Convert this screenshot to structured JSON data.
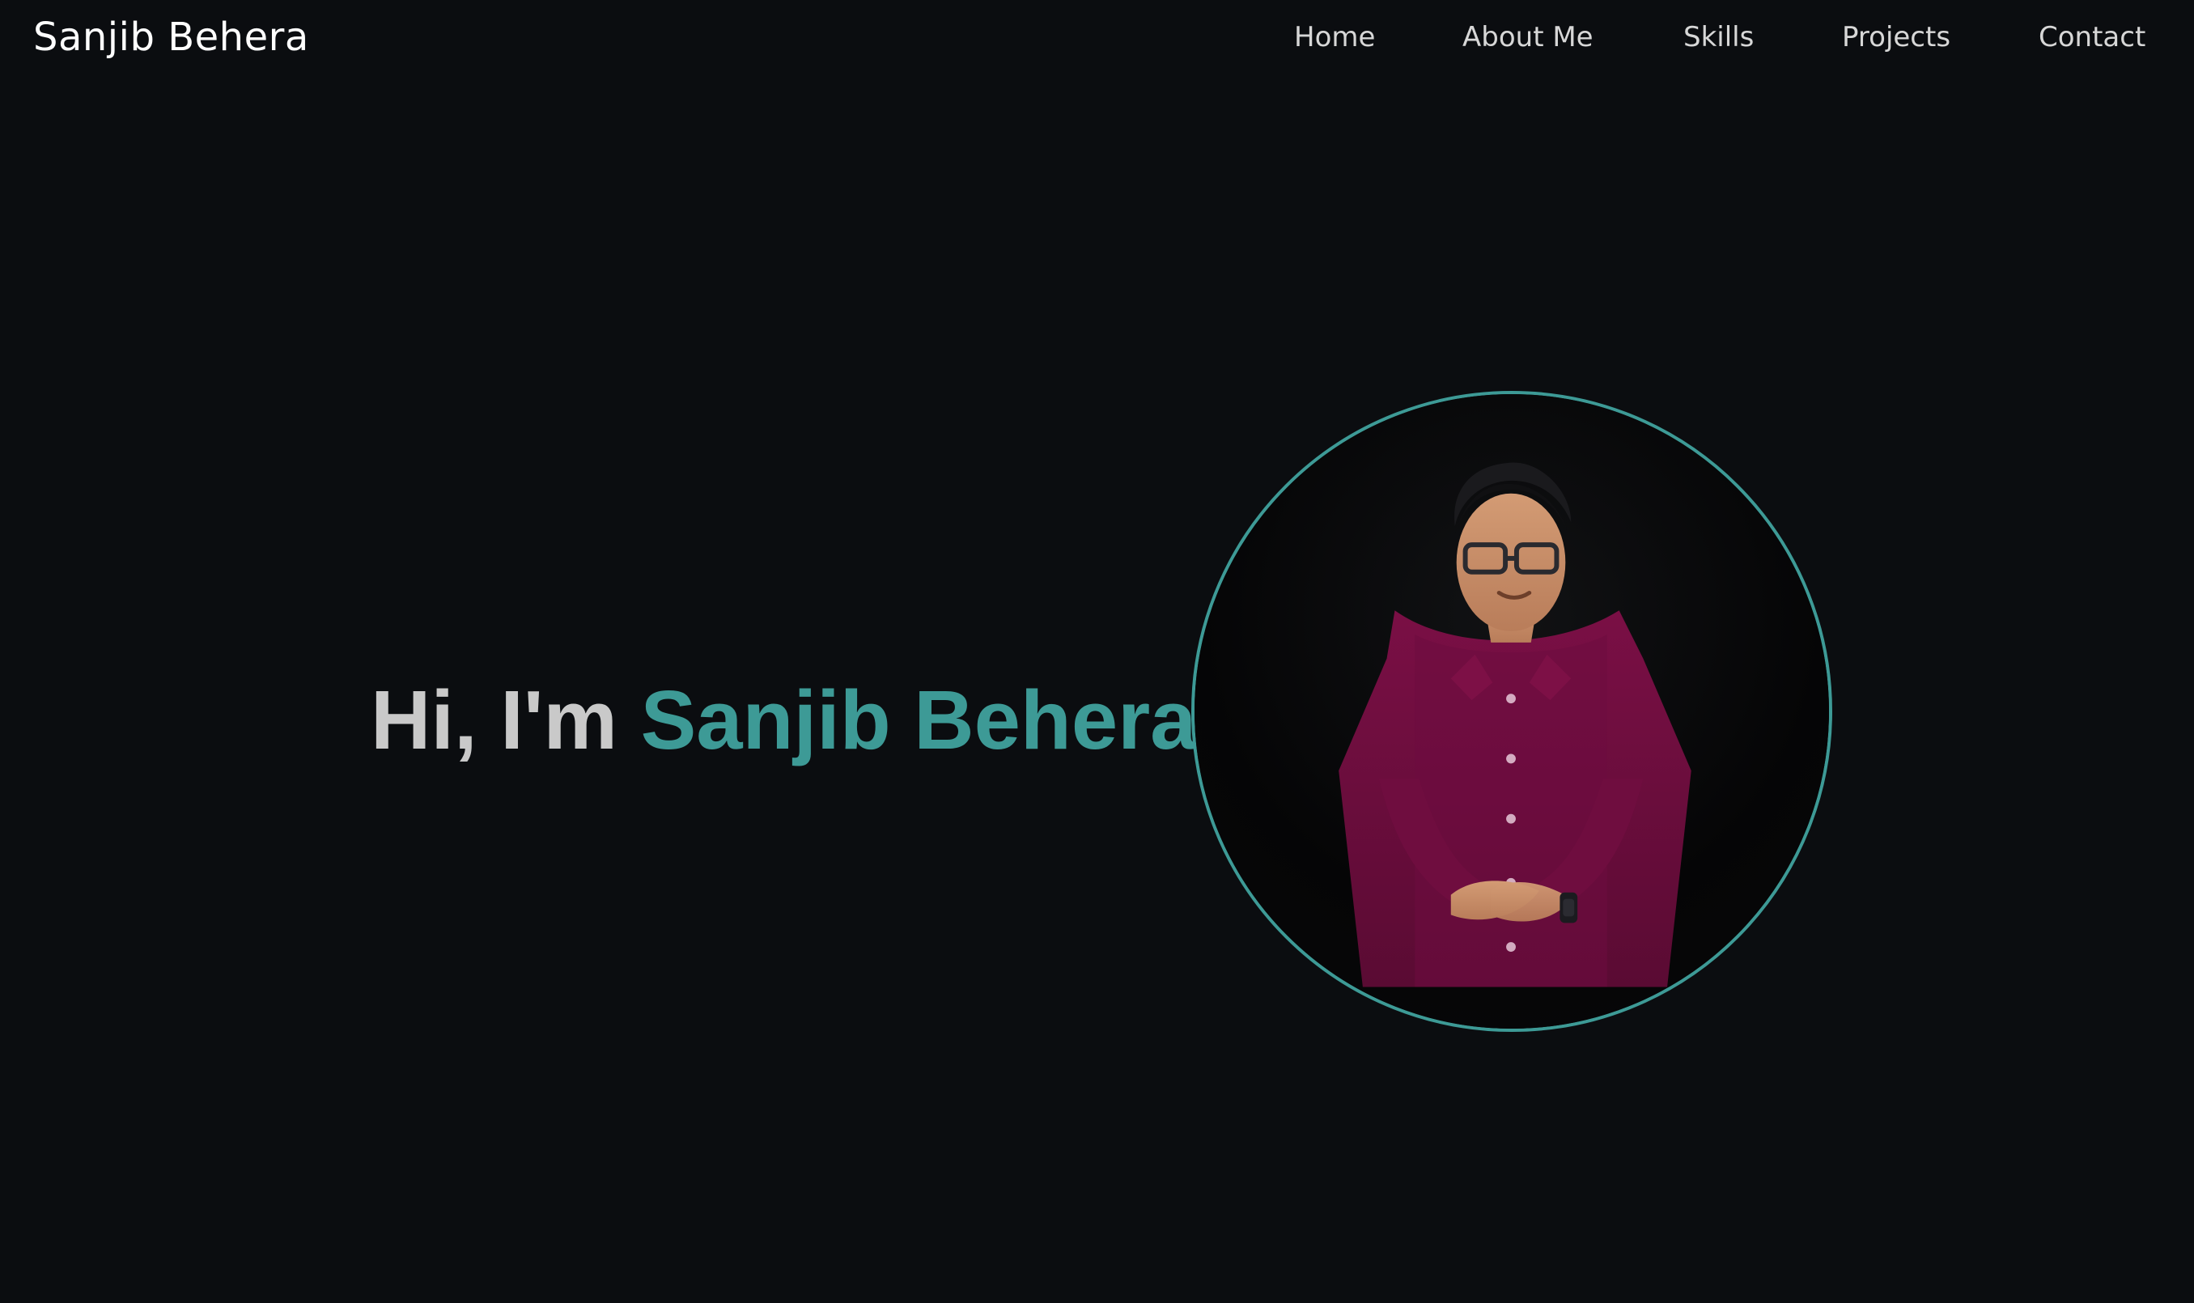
{
  "brand": {
    "name": "Sanjib Behera"
  },
  "nav": {
    "items": [
      {
        "label": "Home"
      },
      {
        "label": "About Me"
      },
      {
        "label": "Skills"
      },
      {
        "label": "Projects"
      },
      {
        "label": "Contact"
      }
    ]
  },
  "hero": {
    "greeting": "Hi, I'm",
    "name": "Sanjib Behera"
  },
  "colors": {
    "background": "#0b0d10",
    "accent": "#3d9a96",
    "text": "#d9d9d9"
  },
  "icons": {
    "portrait": "portrait-photo"
  }
}
